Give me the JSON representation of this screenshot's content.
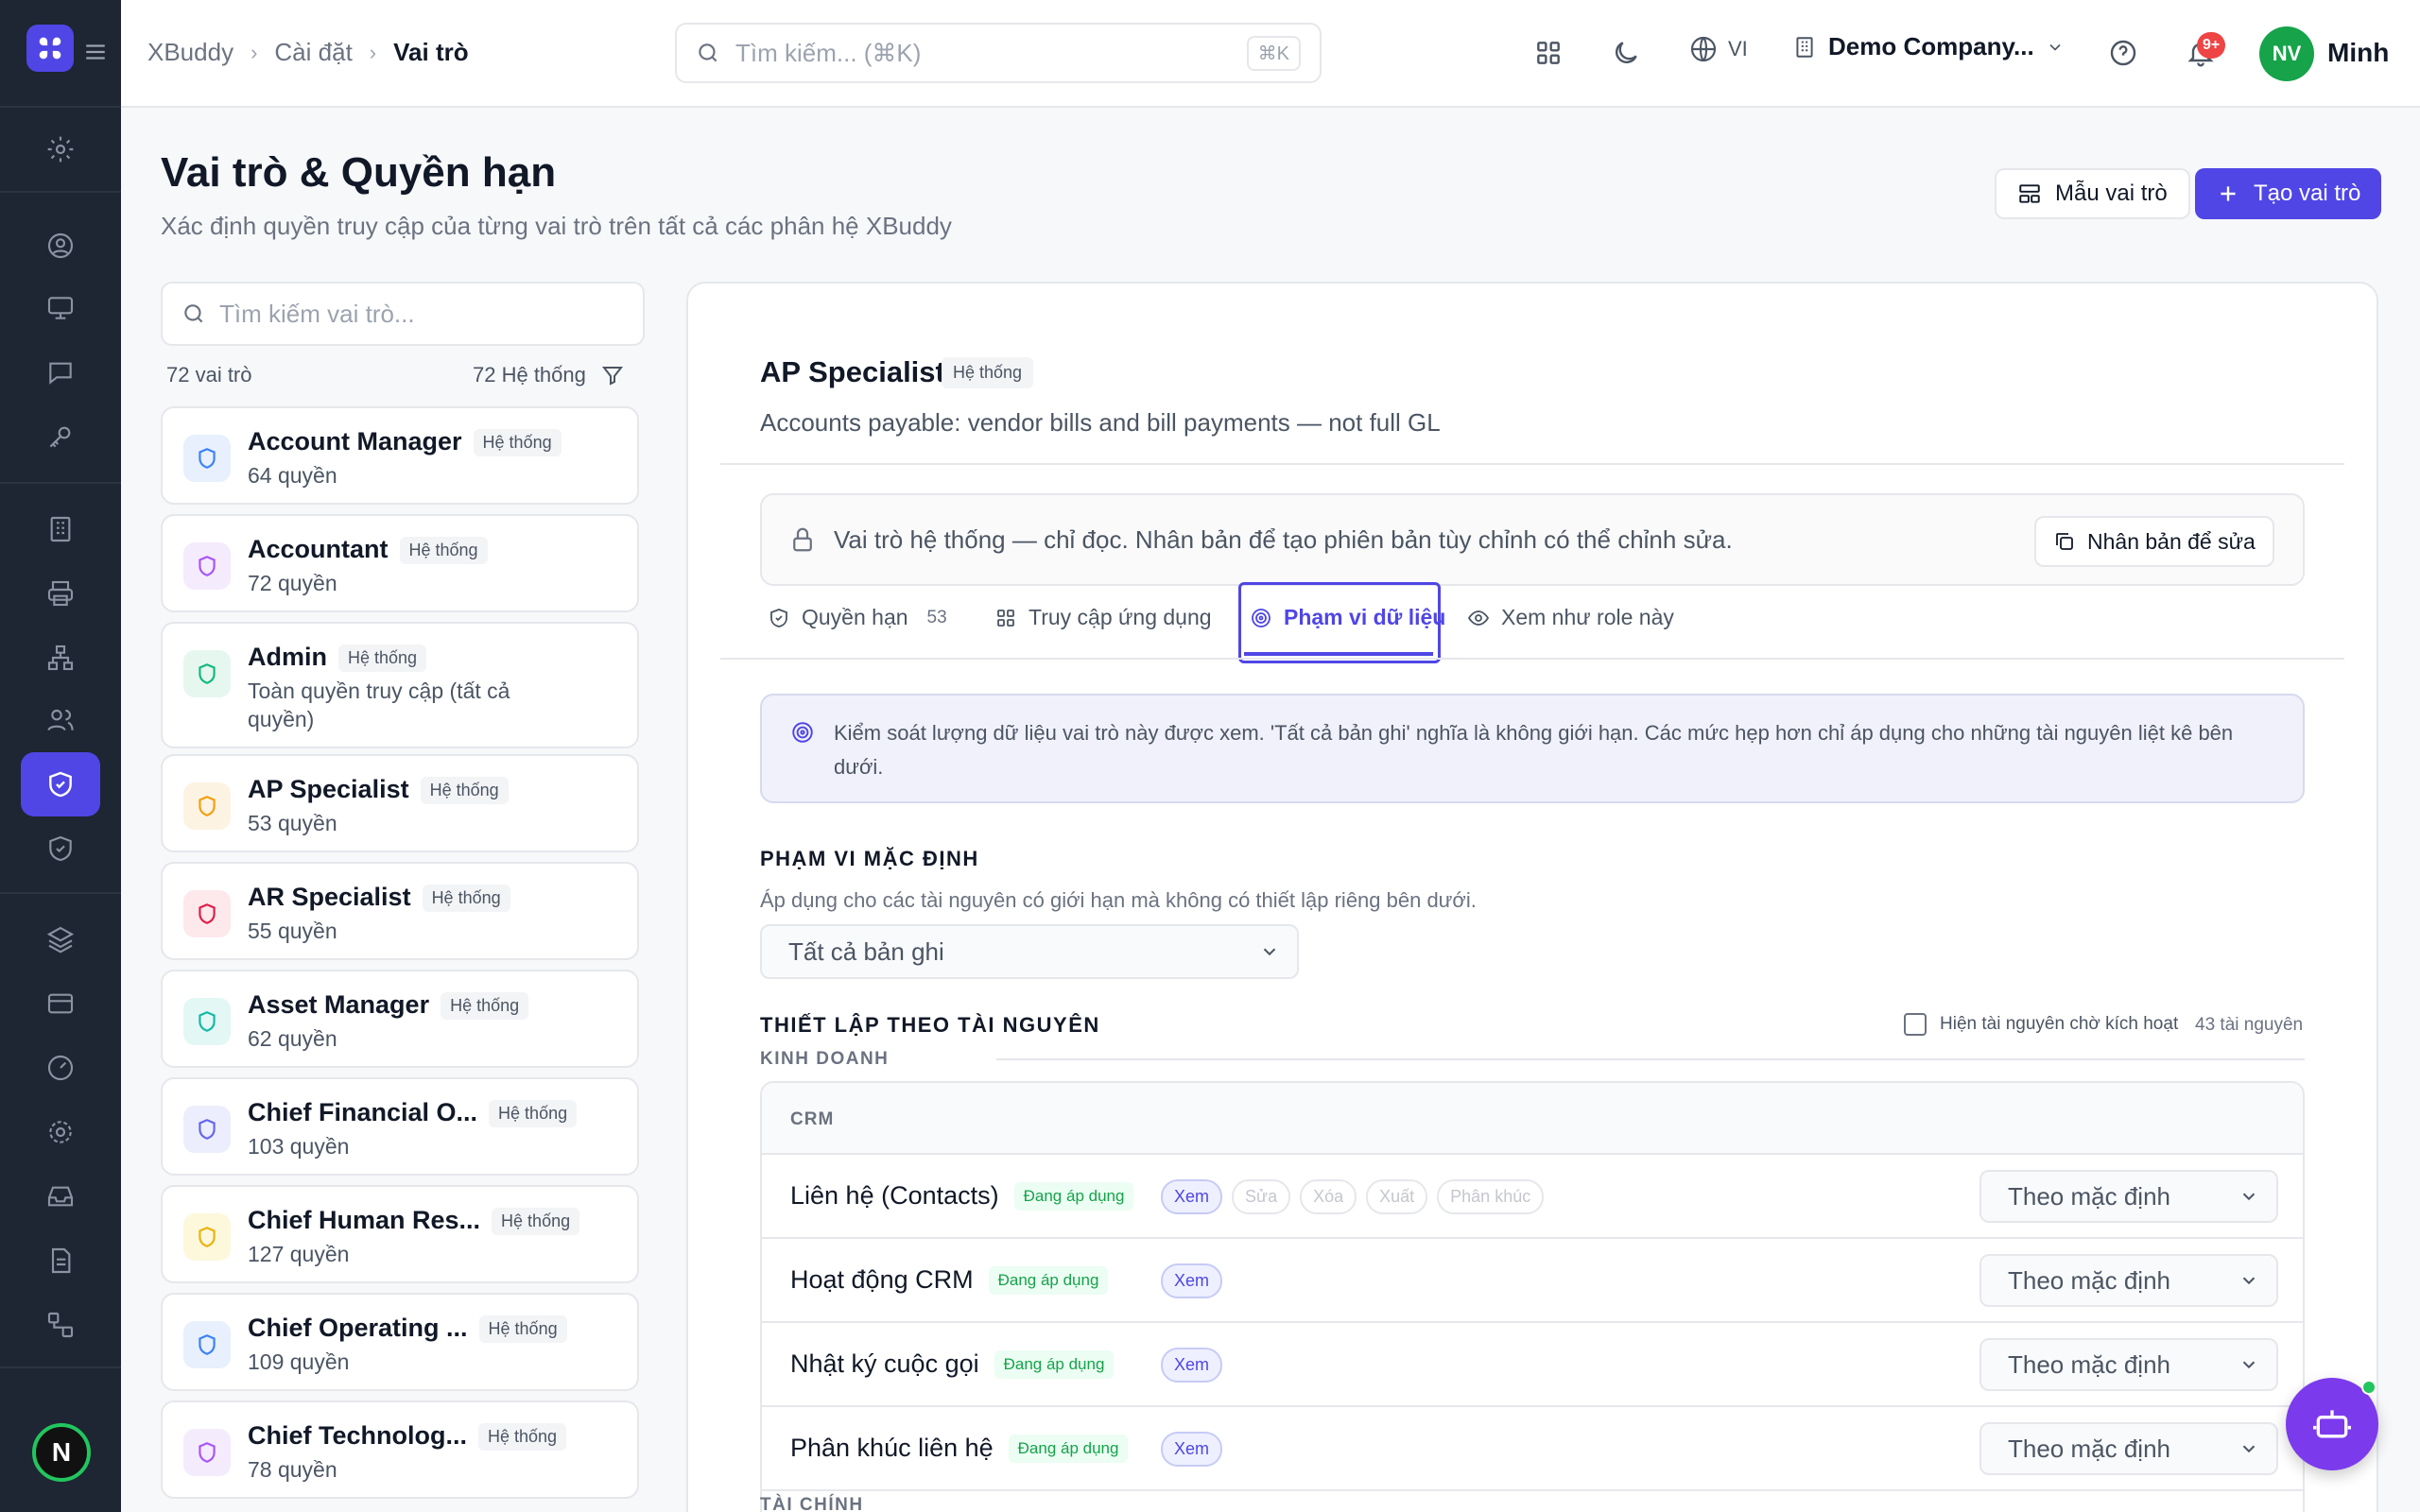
{
  "breadcrumb": {
    "home": "XBuddy",
    "settings": "Cài đặt",
    "current": "Vai trò"
  },
  "search": {
    "placeholder": "Tìm kiếm... (⌘K)",
    "shortcut": "⌘K"
  },
  "topbar": {
    "lang": "VI",
    "company": "Demo Company...",
    "notif_count": "9+",
    "user_initials": "NV",
    "user_name": "Minh"
  },
  "sidebar": {
    "user_initial": "N"
  },
  "header": {
    "title": "Vai trò & Quyền hạn",
    "subtitle": "Xác định quyền truy cập của từng vai trò trên tất cả các phân hệ XBuddy",
    "template_button": "Mẫu vai trò",
    "create_button": "Tạo vai trò"
  },
  "roles_panel": {
    "search_placeholder": "Tìm kiếm vai trò...",
    "count_label": "72 vai trò",
    "system_count_label": "72 Hệ thống",
    "system_badge": "Hệ thống",
    "roles": [
      {
        "name": "Account Manager",
        "sub": "64 quyền",
        "color": "#3b82f6",
        "bg": "#e8effd"
      },
      {
        "name": "Accountant",
        "sub": "72 quyền",
        "color": "#a855f7",
        "bg": "#f4ebfd"
      },
      {
        "name": "Admin",
        "sub": "Toàn quyền truy cập (tất cả quyền)",
        "color": "#10b981",
        "bg": "#e6f7ef"
      },
      {
        "name": "AP Specialist",
        "sub": "53 quyền",
        "color": "#f59e0b",
        "bg": "#fdf3e3"
      },
      {
        "name": "AR Specialist",
        "sub": "55 quyền",
        "color": "#e11d48",
        "bg": "#fde8ec"
      },
      {
        "name": "Asset Manager",
        "sub": "62 quyền",
        "color": "#14b8a6",
        "bg": "#e3f7f4"
      },
      {
        "name": "Chief Financial O...",
        "sub": "103 quyền",
        "color": "#6366f1",
        "bg": "#eceefd"
      },
      {
        "name": "Chief Human Res...",
        "sub": "127 quyền",
        "color": "#eab308",
        "bg": "#fdf7dc"
      },
      {
        "name": "Chief Operating ...",
        "sub": "109 quyền",
        "color": "#3b82f6",
        "bg": "#e8effd"
      },
      {
        "name": "Chief Technolog...",
        "sub": "78 quyền",
        "color": "#a855f7",
        "bg": "#f4ebfd"
      }
    ]
  },
  "detail": {
    "title": "AP Specialist",
    "badge": "Hệ thống",
    "description": "Accounts payable: vendor bills and bill payments — not full GL",
    "readonly_text": "Vai trò hệ thống — chỉ đọc. Nhân bản để tạo phiên bản tùy chỉnh có thể chỉnh sửa.",
    "clone_button": "Nhân bản để sửa",
    "tabs": [
      {
        "label": "Quyền hạn",
        "count": "53"
      },
      {
        "label": "Truy cập ứng dụng"
      },
      {
        "label": "Phạm vi dữ liệu"
      },
      {
        "label": "Xem như role này"
      }
    ],
    "info_text": "Kiểm soát lượng dữ liệu vai trò này được xem. 'Tất cả bản ghi' nghĩa là không giới hạn. Các mức hẹp hơn chỉ áp dụng cho những tài nguyên liệt kê bên dưới.",
    "default_scope_title": "PHẠM VI MẶC ĐỊNH",
    "default_scope_desc": "Áp dụng cho các tài nguyên có giới hạn mà không có thiết lập riêng bên dưới.",
    "default_scope_value": "Tất cả bản ghi",
    "per_resource_title": "THIẾT LẬP THEO TÀI NGUYÊN",
    "show_pending_label": "Hiện tài nguyên chờ kích hoạt",
    "resource_count": "43 tài nguyên",
    "group_business": "KINH DOANH",
    "group_finance": "TÀI CHÍNH",
    "table_header": "CRM",
    "applied_label": "Đang áp dụng",
    "row_default": "Theo mặc định",
    "perm_labels": [
      "Xem",
      "Sửa",
      "Xóa",
      "Xuất",
      "Phân khúc"
    ],
    "rows": [
      {
        "name": "Liên hệ (Contacts)"
      },
      {
        "name": "Hoạt động CRM"
      },
      {
        "name": "Nhật ký cuộc gọi"
      },
      {
        "name": "Phân khúc liên hệ"
      }
    ]
  },
  "colors": {
    "accent": "#4f46e5",
    "sidebar": "#1e2533",
    "success": "#16a34a"
  }
}
